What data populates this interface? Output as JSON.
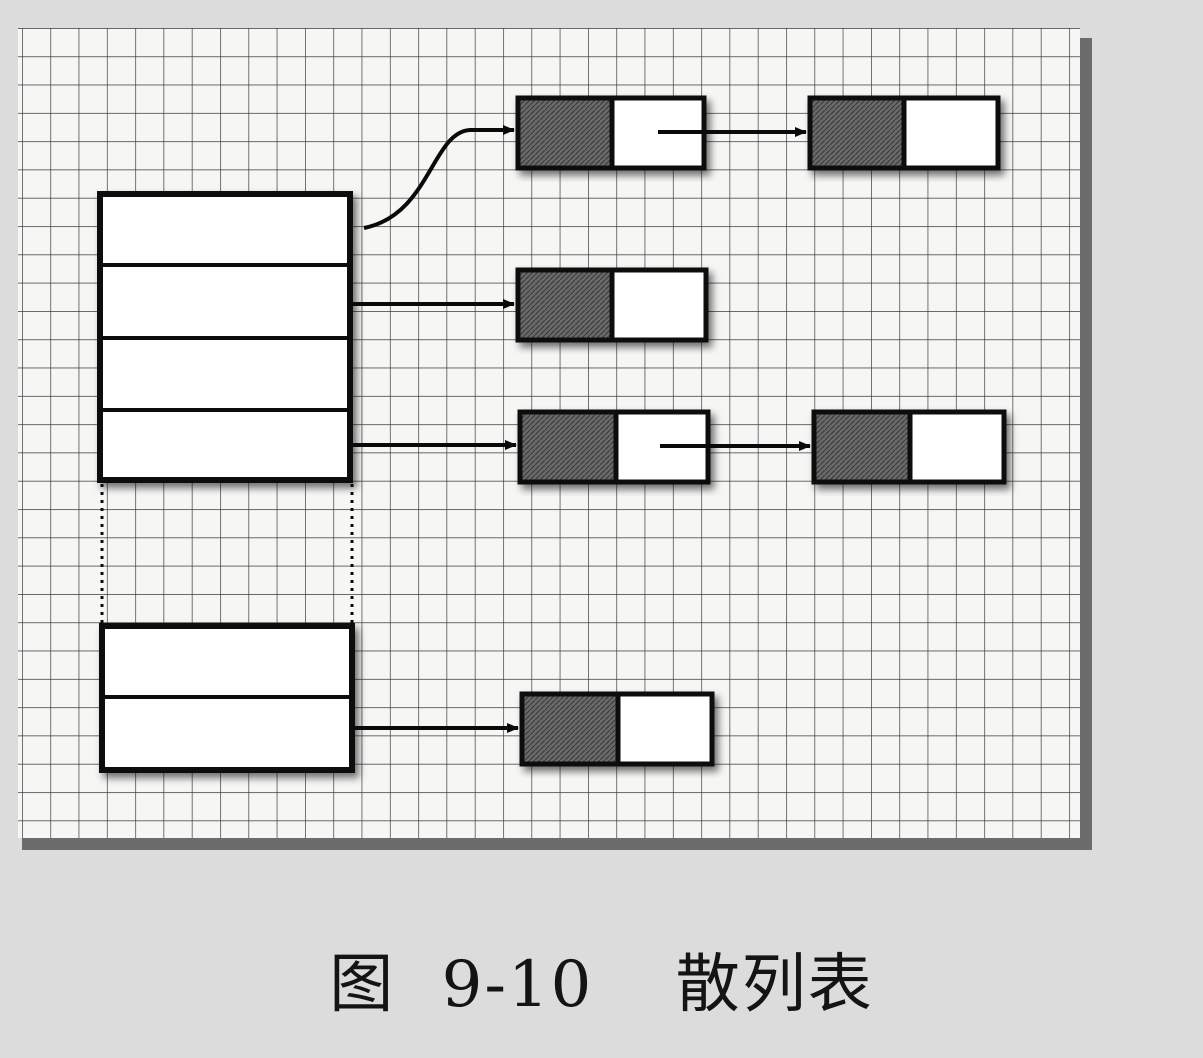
{
  "figure": {
    "label": "图",
    "number": "9-10",
    "title": "散列表"
  },
  "diagram": {
    "description_type": "hash table with separate chaining",
    "buckets_top_group": 4,
    "buckets_bottom_group": 2,
    "colors": {
      "background": "#dcdcdc",
      "panel": "#f6f6f4",
      "grid_line": "#3a3a3a",
      "node_key": "#5a5a5a",
      "node_value": "#ffffff",
      "border": "#0a0a0a"
    }
  }
}
